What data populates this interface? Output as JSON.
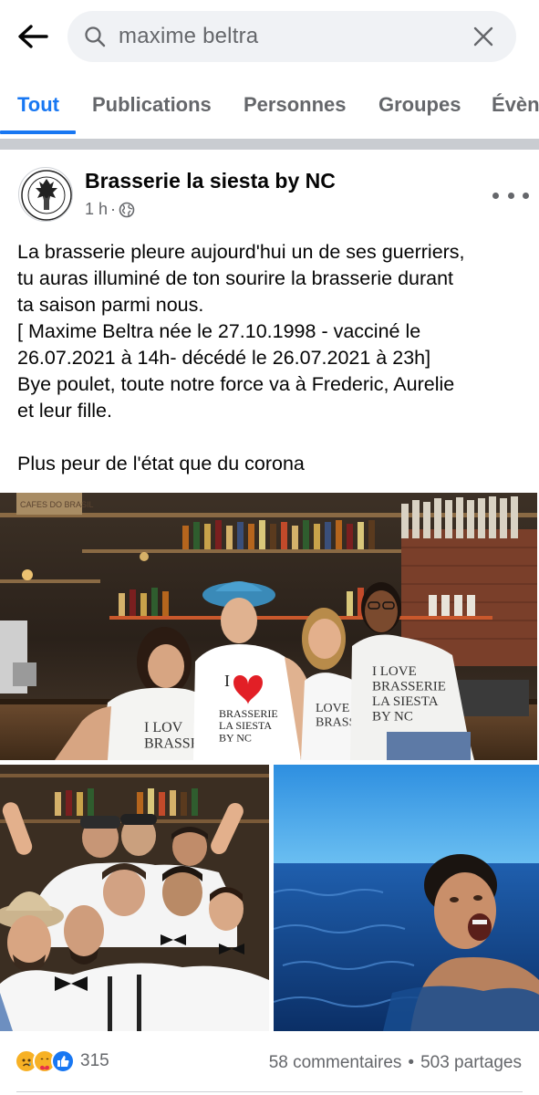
{
  "search": {
    "query": "maxime beltra"
  },
  "tabs": [
    {
      "label": "Tout",
      "active": true
    },
    {
      "label": "Publications",
      "active": false
    },
    {
      "label": "Personnes",
      "active": false
    },
    {
      "label": "Groupes",
      "active": false
    },
    {
      "label": "Évèn",
      "active": false
    }
  ],
  "post": {
    "page_name": "Brasserie la siesta by NC",
    "time": "1 h",
    "separator": "·",
    "privacy_icon": "globe-icon",
    "lines": [
      "La brasserie pleure aujourd'hui un de ses guerriers,",
      "tu auras illuminé de ton sourire la brasserie durant",
      "ta saison parmi nous.",
      "[ Maxime Beltra née le 27.10.1998 - vacciné le",
      "26.07.2021 à 14h- décédé le 26.07.2021 à 23h]",
      "Bye poulet, toute notre force va à Frederic, Aurelie",
      "et leur fille.",
      "",
      "Plus peur de l'état que du corona"
    ],
    "photo_main_text": {
      "sack_label": "CAFES DO BRASIL",
      "shirt1": "I LOV\nBRASSER",
      "shirt2_top": "I",
      "shirt2": "BRASSERIE\nLA SIESTA\nBY NC",
      "shirt3": "LOVE\nBRASSE",
      "shirt4": "I LOVE\nBRASSERIE\nLA SIESTA\nBY NC"
    }
  },
  "footer": {
    "reaction_icons": [
      "sad-icon",
      "care-icon",
      "like-icon"
    ],
    "reaction_count": "315",
    "comments": "58 commentaires",
    "dot": "•",
    "shares": "503 partages"
  },
  "colors": {
    "accent": "#1877f2",
    "secondary_text": "#65676b",
    "search_bg": "#f0f2f5"
  }
}
